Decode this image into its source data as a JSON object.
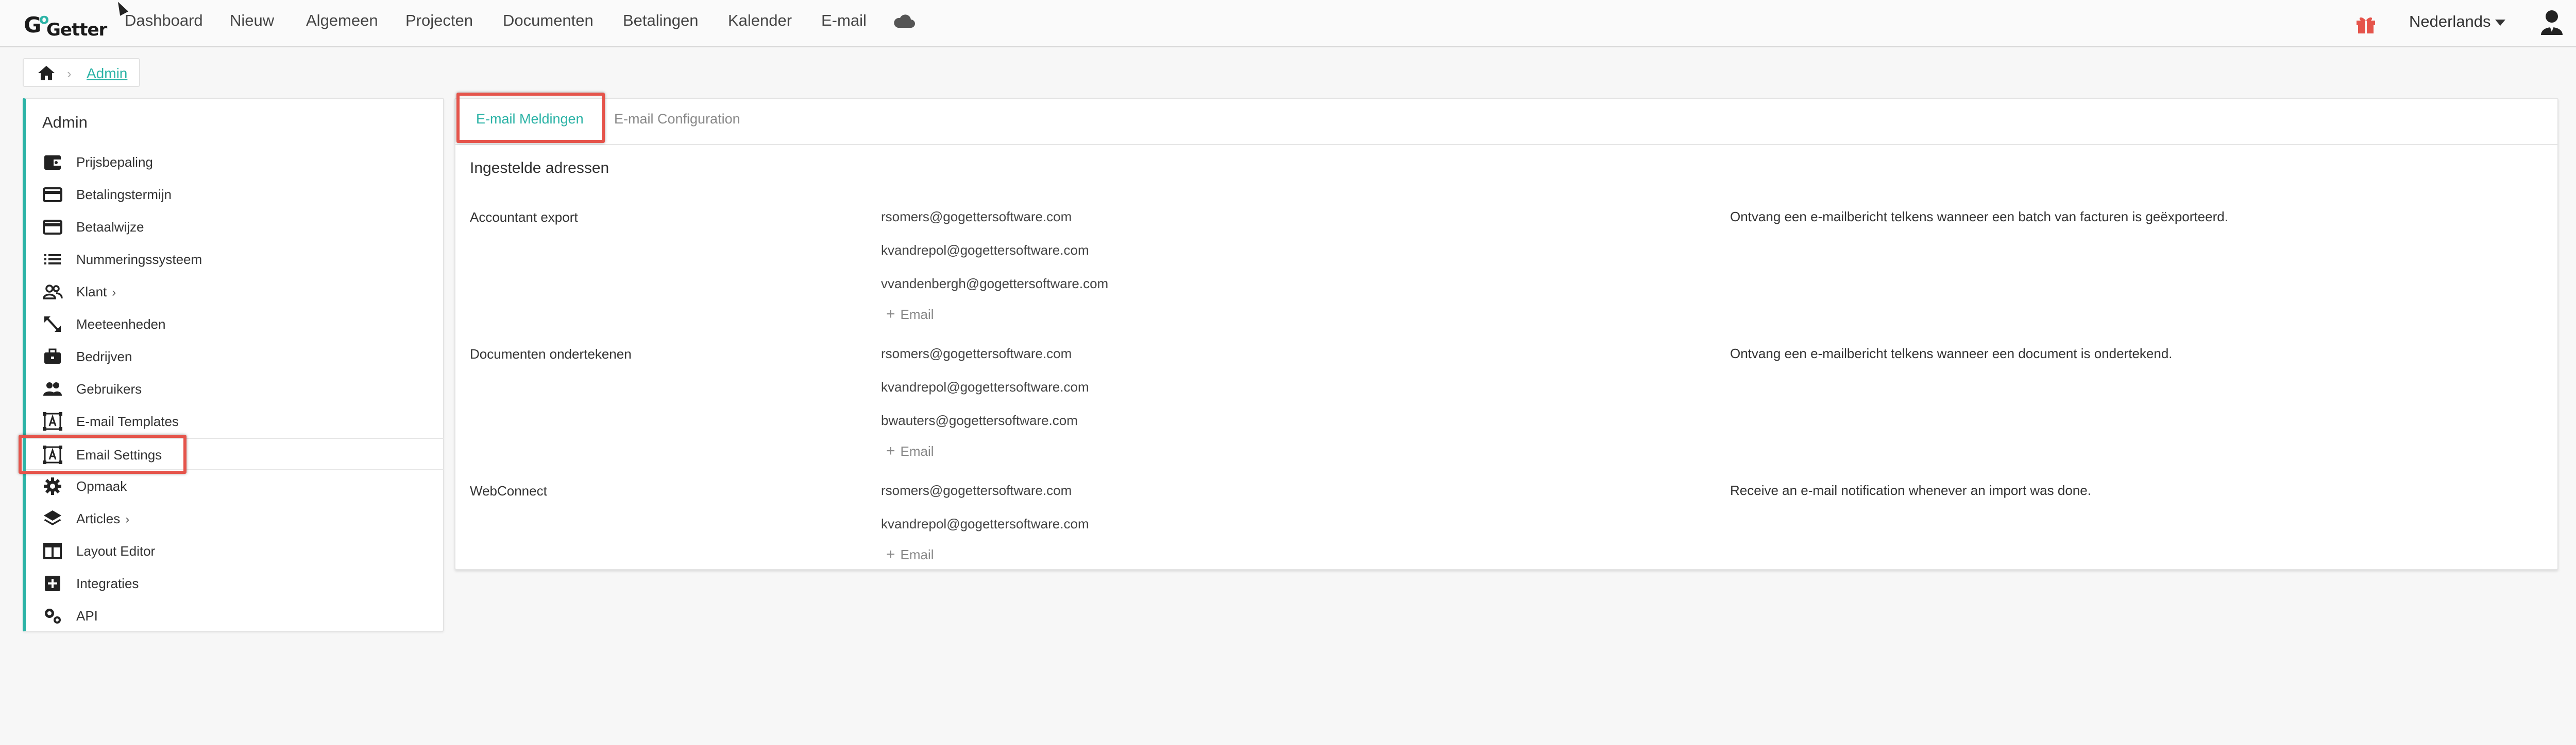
{
  "navbar": {
    "logo_alt": "GoGetter",
    "items": [
      "Dashboard",
      "Nieuw",
      "Algemeen",
      "Projecten",
      "Documenten",
      "Betalingen",
      "Kalender",
      "E-mail"
    ],
    "language": "Nederlands",
    "icons": [
      "cloud-icon",
      "gift-icon",
      "user-icon"
    ],
    "accent_color": "#2bb3a6"
  },
  "breadcrumb": {
    "home_icon": "home-icon",
    "current": "Admin"
  },
  "sidebar": {
    "title": "Admin",
    "items": [
      {
        "label": "Prijsbepaling",
        "icon": "wallet-icon"
      },
      {
        "label": "Betalingstermijn",
        "icon": "credit-card-icon"
      },
      {
        "label": "Betaalwijze",
        "icon": "credit-card-icon"
      },
      {
        "label": "Nummeringssysteem",
        "icon": "list-icon"
      },
      {
        "label": "Klant",
        "icon": "people-icon",
        "has_submenu": true
      },
      {
        "label": "Meeteenheden",
        "icon": "resize-arrows-icon"
      },
      {
        "label": "Bedrijven",
        "icon": "briefcase-icon"
      },
      {
        "label": "Gebruikers",
        "icon": "users-icon"
      },
      {
        "label": "E-mail Templates",
        "icon": "template-icon"
      },
      {
        "label": "Email Settings",
        "icon": "template-icon",
        "active": true
      },
      {
        "label": "Opmaak",
        "icon": "gear-icon"
      },
      {
        "label": "Articles",
        "icon": "layers-icon",
        "has_submenu": true
      },
      {
        "label": "Layout Editor",
        "icon": "layout-icon"
      },
      {
        "label": "Integraties",
        "icon": "plus-box-icon"
      },
      {
        "label": "API",
        "icon": "gears-icon"
      }
    ],
    "highlight_color": "#e5544b"
  },
  "tabs": [
    {
      "label": "E-mail Meldingen",
      "active": true
    },
    {
      "label": "E-mail Configuration",
      "active": false
    }
  ],
  "section_title": "Ingestelde adressen",
  "add_email_label": "Email",
  "groups": [
    {
      "label": "Accountant export",
      "emails": [
        "rsomers@gogettersoftware.com",
        "kvandrepol@gogettersoftware.com",
        "vvandenbergh@gogettersoftware.com"
      ],
      "description": "Ontvang een e-mailbericht telkens wanneer een batch van facturen is geëxporteerd."
    },
    {
      "label": "Documenten ondertekenen",
      "emails": [
        "rsomers@gogettersoftware.com",
        "kvandrepol@gogettersoftware.com",
        "bwauters@gogettersoftware.com"
      ],
      "description": "Ontvang een e-mailbericht telkens wanneer een document is ondertekend."
    },
    {
      "label": "WebConnect",
      "emails": [
        "rsomers@gogettersoftware.com",
        "kvandrepol@gogettersoftware.com"
      ],
      "description": "Receive an e-mail notification whenever an import was done."
    }
  ]
}
